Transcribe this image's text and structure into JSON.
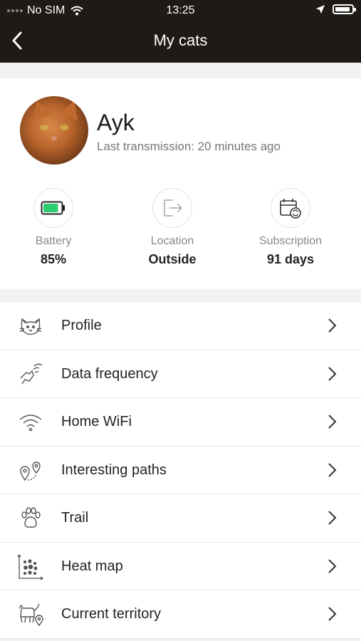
{
  "status_bar": {
    "carrier": "No SIM",
    "time": "13:25"
  },
  "nav": {
    "title": "My cats"
  },
  "cat": {
    "name": "Ayk",
    "last_transmission": "Last transmission: 20 minutes ago"
  },
  "stats": [
    {
      "label": "Battery",
      "value": "85%",
      "icon": "battery-icon"
    },
    {
      "label": "Location",
      "value": "Outside",
      "icon": "exit-icon"
    },
    {
      "label": "Subscription",
      "value": "91 days",
      "icon": "calendar-refresh-icon"
    }
  ],
  "battery_level": 0.85,
  "menu": [
    {
      "label": "Profile",
      "icon": "cat-face-icon"
    },
    {
      "label": "Data frequency",
      "icon": "cat-signal-icon"
    },
    {
      "label": "Home WiFi",
      "icon": "wifi-icon"
    },
    {
      "label": "Interesting paths",
      "icon": "map-pins-icon"
    },
    {
      "label": "Trail",
      "icon": "paw-icon"
    },
    {
      "label": "Heat map",
      "icon": "dot-grid-icon"
    },
    {
      "label": "Current territory",
      "icon": "cat-location-icon"
    }
  ],
  "colors": {
    "topbar": "#1e1a16",
    "battery_fill": "#2ecc71"
  }
}
